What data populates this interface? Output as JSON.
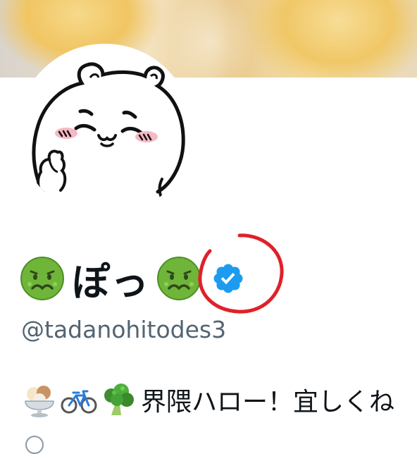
{
  "profile": {
    "display_name": "ぽっ",
    "handle": "@tadanohitodes3",
    "bio_text": "界隈ハロー！宜しくね",
    "verified": true
  },
  "icons": {
    "name_emoji": "nauseated-face",
    "verified_badge": "verified-checkmark",
    "bio_emojis": [
      "ice-cream",
      "bicycle",
      "broccoli"
    ]
  },
  "colors": {
    "text_primary": "#0f1419",
    "text_secondary": "#536471",
    "verified_blue": "#1d9bf0",
    "annotation_red": "#e0202a"
  }
}
